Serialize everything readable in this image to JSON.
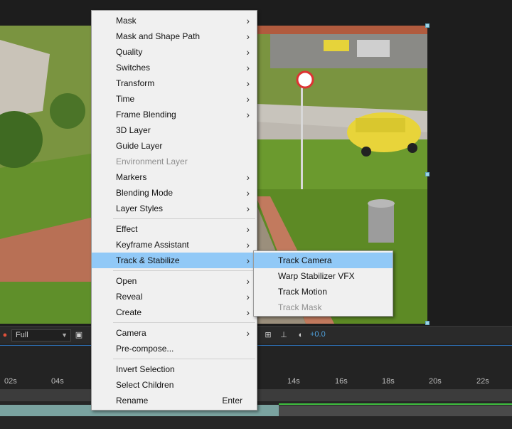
{
  "menu": {
    "groups": [
      [
        {
          "label": "Mask",
          "submenu": true
        },
        {
          "label": "Mask and Shape Path",
          "submenu": true
        },
        {
          "label": "Quality",
          "submenu": true
        },
        {
          "label": "Switches",
          "submenu": true
        },
        {
          "label": "Transform",
          "submenu": true
        },
        {
          "label": "Time",
          "submenu": true
        },
        {
          "label": "Frame Blending",
          "submenu": true
        },
        {
          "label": "3D Layer"
        },
        {
          "label": "Guide Layer"
        },
        {
          "label": "Environment Layer",
          "disabled": true
        },
        {
          "label": "Markers",
          "submenu": true
        },
        {
          "label": "Blending Mode",
          "submenu": true
        },
        {
          "label": "Layer Styles",
          "submenu": true
        }
      ],
      [
        {
          "label": "Effect",
          "submenu": true
        },
        {
          "label": "Keyframe Assistant",
          "submenu": true
        },
        {
          "label": "Track & Stabilize",
          "submenu": true,
          "highlighted": true
        }
      ],
      [
        {
          "label": "Open",
          "submenu": true
        },
        {
          "label": "Reveal",
          "submenu": true
        },
        {
          "label": "Create",
          "submenu": true
        }
      ],
      [
        {
          "label": "Camera",
          "submenu": true
        },
        {
          "label": "Pre-compose..."
        }
      ],
      [
        {
          "label": "Invert Selection"
        },
        {
          "label": "Select Children"
        },
        {
          "label": "Rename",
          "shortcut": "Enter"
        }
      ]
    ]
  },
  "submenu": {
    "items": [
      {
        "label": "Track Camera",
        "highlighted": true
      },
      {
        "label": "Warp Stabilizer VFX"
      },
      {
        "label": "Track Motion"
      },
      {
        "label": "Track Mask",
        "disabled": true
      }
    ]
  },
  "viewer_toolbar": {
    "resolution": "Full",
    "exposure": "+0.0"
  },
  "timeline": {
    "ruler_ticks": [
      "02s",
      "04s",
      "14s",
      "16s",
      "18s",
      "20s",
      "22s"
    ]
  },
  "colors": {
    "menu_bg": "#f0f0f0",
    "highlight": "#91c9f7",
    "accent_blue": "#4fa3e0",
    "layer_bar": "#7aa3a0",
    "work_area_green": "#3fbf3f"
  }
}
